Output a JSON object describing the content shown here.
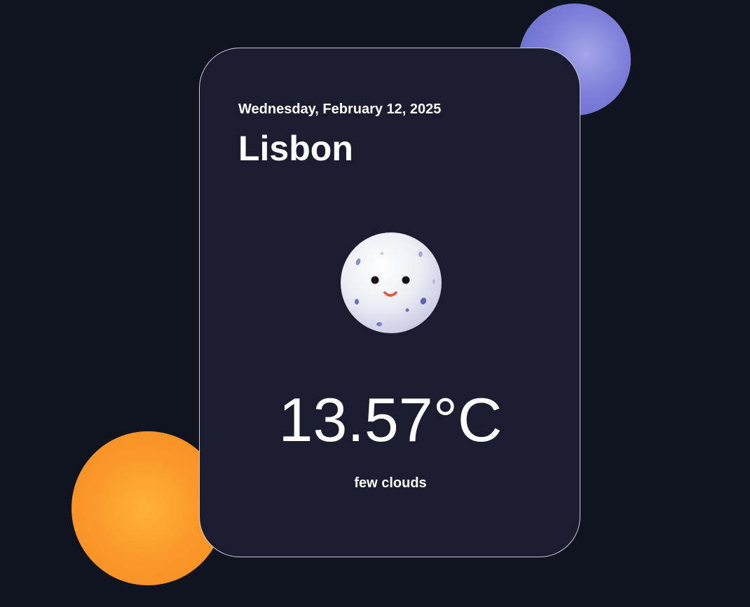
{
  "weather": {
    "date": "Wednesday, February 12, 2025",
    "city": "Lisbon",
    "temperature": "13.57°C",
    "description": "few clouds",
    "icon": "moon-face-icon"
  },
  "colors": {
    "background": "#10141e",
    "card": "#1b1c30",
    "card_border": "#c9cbd8",
    "orb_purple": "#7d7fd9",
    "orb_orange": "#fb9a2a",
    "text": "#ffffff"
  }
}
